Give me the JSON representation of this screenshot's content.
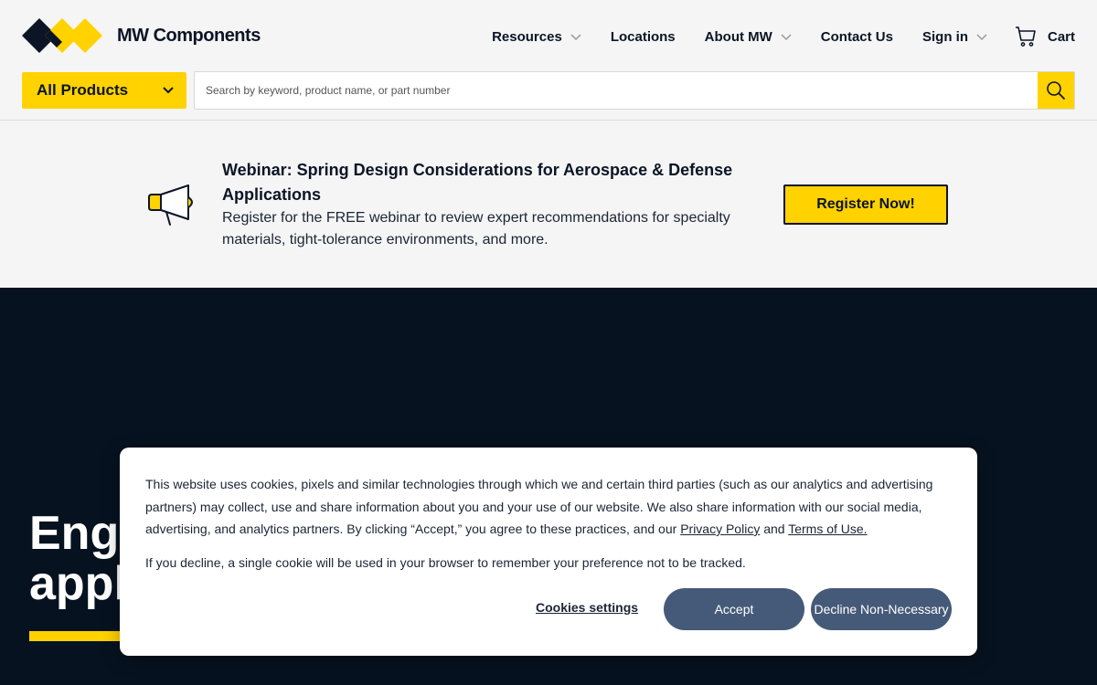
{
  "brand": {
    "name": "MW Components",
    "colors": {
      "accent": "#ffd200",
      "dark": "#06121f",
      "button": "#455a78"
    }
  },
  "nav": {
    "resources": "Resources",
    "locations": "Locations",
    "about": "About MW",
    "contact": "Contact Us",
    "signin": "Sign in",
    "cart": "Cart"
  },
  "search": {
    "category_label": "All Products",
    "placeholder": "Search by keyword, product name, or part number",
    "value": ""
  },
  "promo": {
    "icon": "megaphone-icon",
    "title": "Webinar: Spring Design Considerations for Aerospace & Defense Applications",
    "body": "Register for the FREE webinar to review expert recommendations for specialty materials, tight-tolerance environments, and more.",
    "button": "Register Now!"
  },
  "hero": {
    "title_visible": "Eng\nappl"
  },
  "cookie": {
    "text_part1": "This website uses cookies, pixels and similar technologies through which we and certain third parties (such as our analytics and advertising partners) may collect, use and share information about you and your use of our website. We also share information with our social media, advertising, and analytics partners. By clicking “Accept,” you agree to these practices, and our ",
    "privacy_link": "Privacy Policy",
    "and": " and ",
    "terms_link": "Terms of Use.",
    "text2": "If you decline, a single cookie will be used in your browser to remember your preference not to be tracked.",
    "settings": "Cookies settings",
    "accept": "Accept",
    "decline": "Decline Non-Necessary"
  }
}
